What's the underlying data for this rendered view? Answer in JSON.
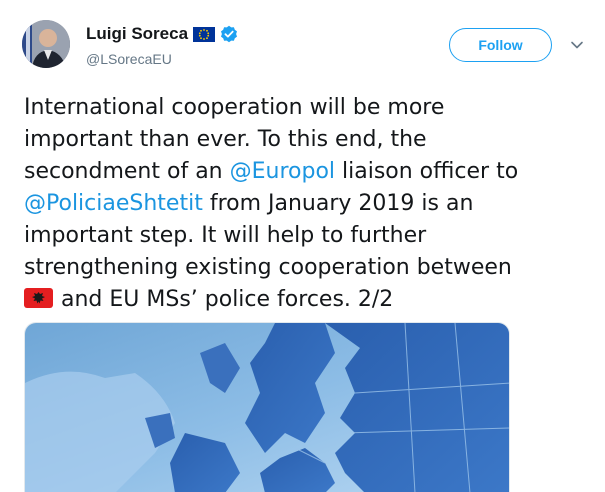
{
  "user": {
    "display_name": "Luigi Soreca",
    "handle": "@LSorecaEU",
    "avatar_icon": "profile-photo",
    "flag_icon": "eu-flag-icon",
    "verified_icon": "verified-badge-icon"
  },
  "actions": {
    "follow_label": "Follow",
    "menu_icon": "chevron-down-icon"
  },
  "tweet": {
    "line1": "International cooperation will be more",
    "line2": "important than ever. To this end, the",
    "line3_a": "secondment of an ",
    "line3_mention": "@Europol",
    "line3_b": " liaison officer to",
    "line4_mention": "@PoliciaeShtetit",
    "line4_b": " from January 2019 is an",
    "line5": "important step. It will help to further",
    "line6": "strengthening existing cooperation between",
    "line7_flag_icon": "albania-flag-emoji",
    "line7_b": "and EU MSs’ police forces. 2/2"
  },
  "media": {
    "image_icon": "europe-map-image"
  },
  "colors": {
    "link": "#1b95e0",
    "follow": "#1da1f2",
    "text": "#14171a",
    "secondary": "#657786"
  }
}
